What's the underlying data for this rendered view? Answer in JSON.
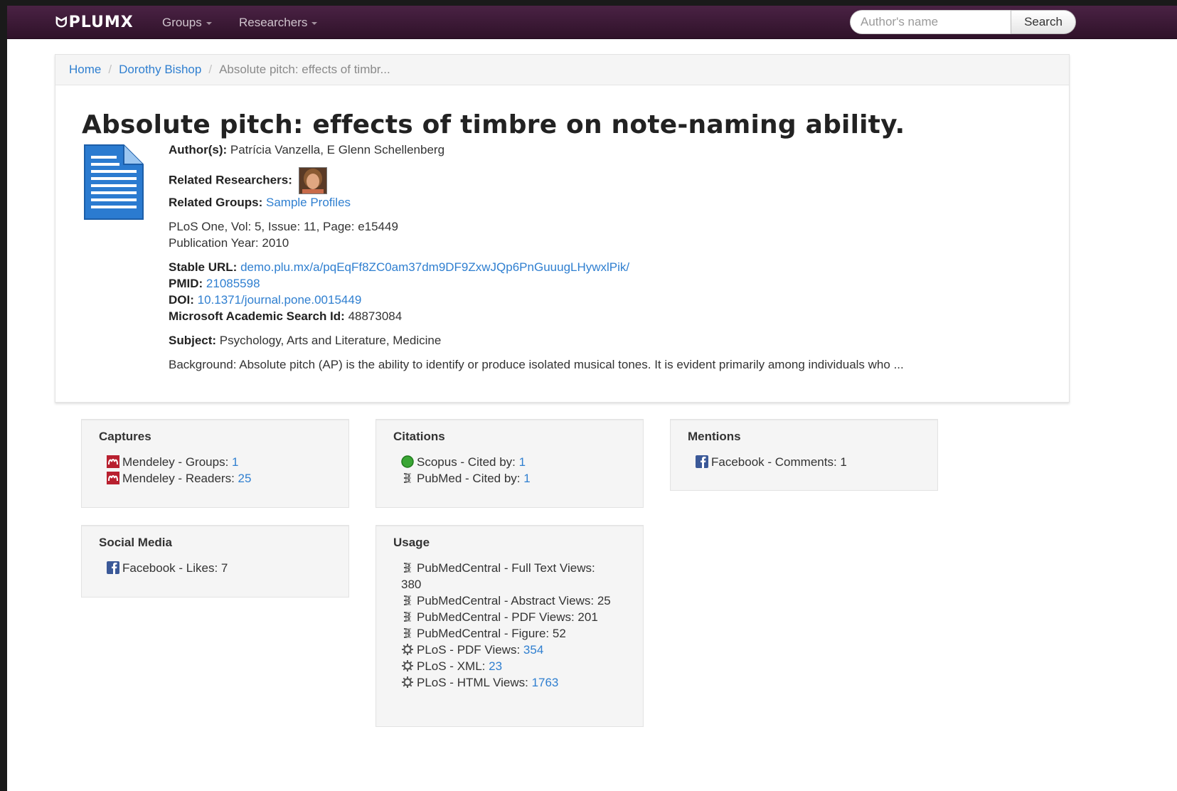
{
  "nav": {
    "brand": "PLUMX",
    "items": [
      {
        "label": "Groups"
      },
      {
        "label": "Researchers"
      }
    ],
    "search_placeholder": "Author's name",
    "search_button": "Search"
  },
  "breadcrumb": {
    "home": "Home",
    "researcher": "Dorothy Bishop",
    "current": "Absolute pitch: effects of timbr..."
  },
  "article": {
    "title": "Absolute pitch: effects of timbre on note-naming ability.",
    "authors_label": "Author(s):",
    "authors": "Patrícia Vanzella, E Glenn Schellenberg",
    "related_researchers_label": "Related Researchers:",
    "related_groups_label": "Related Groups:",
    "related_group": "Sample Profiles",
    "journal": "PLoS One, Vol: 5, Issue: 11, Page: e15449",
    "pub_year": "Publication Year: 2010",
    "stable_url_label": "Stable URL:",
    "stable_url": "demo.plu.mx/a/pqEqFf8ZC0am37dm9DF9ZxwJQp6PnGuuugLHywxlPik/",
    "pmid_label": "PMID:",
    "pmid": "21085598",
    "doi_label": "DOI:",
    "doi": "10.1371/journal.pone.0015449",
    "msas_label": "Microsoft Academic Search Id:",
    "msas": "48873084",
    "subject_label": "Subject:",
    "subject": "Psychology, Arts and Literature, Medicine",
    "abstract": "Background: Absolute pitch (AP) is the ability to identify or produce isolated musical tones. It is evident primarily among individuals who ..."
  },
  "panels": {
    "captures": {
      "title": "Captures",
      "items": [
        {
          "icon": "mendeley-icon",
          "label": "Mendeley - Groups:",
          "value": "1"
        },
        {
          "icon": "mendeley-icon",
          "label": "Mendeley - Readers:",
          "value": "25"
        }
      ]
    },
    "citations": {
      "title": "Citations",
      "items": [
        {
          "icon": "scopus-icon",
          "label": "Scopus - Cited by:",
          "value": "1"
        },
        {
          "icon": "pubmed-icon",
          "label": "PubMed - Cited by:",
          "value": "1"
        }
      ]
    },
    "mentions": {
      "title": "Mentions",
      "items": [
        {
          "icon": "facebook-icon",
          "label": "Facebook - Comments: 1"
        }
      ]
    },
    "social": {
      "title": "Social Media",
      "items": [
        {
          "icon": "facebook-icon",
          "label": "Facebook - Likes: 7"
        }
      ]
    },
    "usage": {
      "title": "Usage",
      "items": [
        {
          "icon": "pubmed-icon",
          "label": "PubMedCentral - Full Text Views: 380"
        },
        {
          "icon": "pubmed-icon",
          "label": "PubMedCentral - Abstract Views: 25"
        },
        {
          "icon": "pubmed-icon",
          "label": "PubMedCentral - PDF Views: 201"
        },
        {
          "icon": "pubmed-icon",
          "label": "PubMedCentral - Figure: 52"
        },
        {
          "icon": "plos-icon",
          "label": "PLoS - PDF Views:",
          "value": "354"
        },
        {
          "icon": "plos-icon",
          "label": "PLoS - XML:",
          "value": "23"
        },
        {
          "icon": "plos-icon",
          "label": "PLoS - HTML Views:",
          "value": "1763"
        }
      ]
    }
  },
  "colors": {
    "navbar": "#3b1a36",
    "link": "#2f7fd0",
    "mendeley": "#b8202f",
    "scopus": "#3aa635",
    "facebook": "#3b5998",
    "doc_icon": "#2b7bd0"
  }
}
